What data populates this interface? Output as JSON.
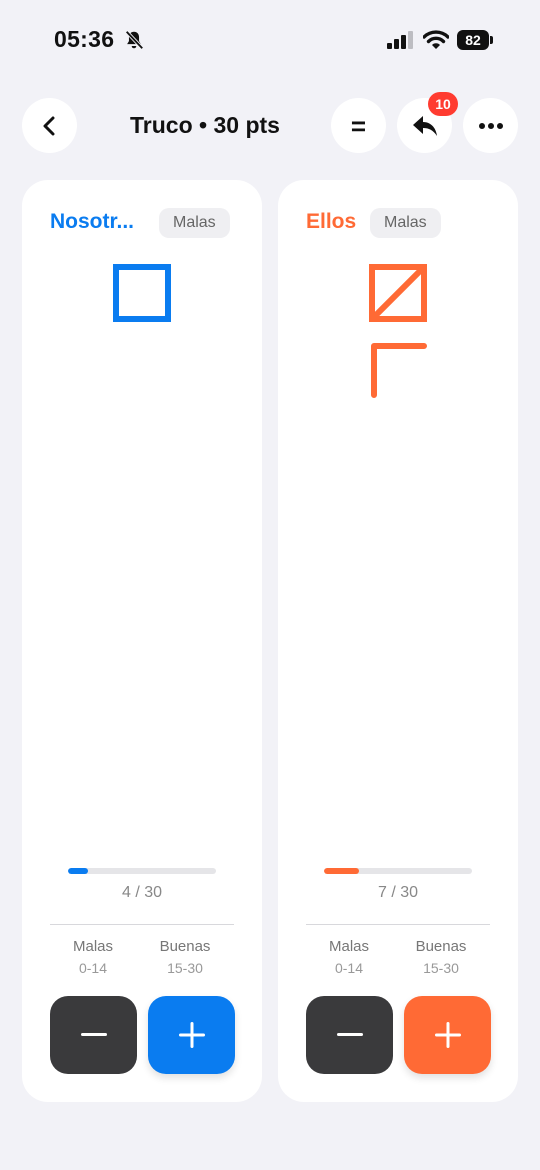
{
  "status_bar": {
    "time": "05:36",
    "battery": "82"
  },
  "header": {
    "title": "Truco • 30 pts",
    "equal_label": "=",
    "undo_badge": "10"
  },
  "colors": {
    "blue": "#0a7cf0",
    "orange": "#ff6a35",
    "dark_button": "#3a3a3c"
  },
  "teams": [
    {
      "name": "Nosotr...",
      "status": "Malas",
      "score_text": "4 / 30",
      "score": 4,
      "max": 30,
      "ranges": [
        {
          "label": "Malas",
          "value": "0-14"
        },
        {
          "label": "Buenas",
          "value": "15-30"
        }
      ],
      "minus_icon": "minus-icon",
      "plus_icon": "plus-icon"
    },
    {
      "name": "Ellos",
      "status": "Malas",
      "score_text": "7 / 30",
      "score": 7,
      "max": 30,
      "ranges": [
        {
          "label": "Malas",
          "value": "0-14"
        },
        {
          "label": "Buenas",
          "value": "15-30"
        }
      ],
      "minus_icon": "minus-icon",
      "plus_icon": "plus-icon"
    }
  ]
}
